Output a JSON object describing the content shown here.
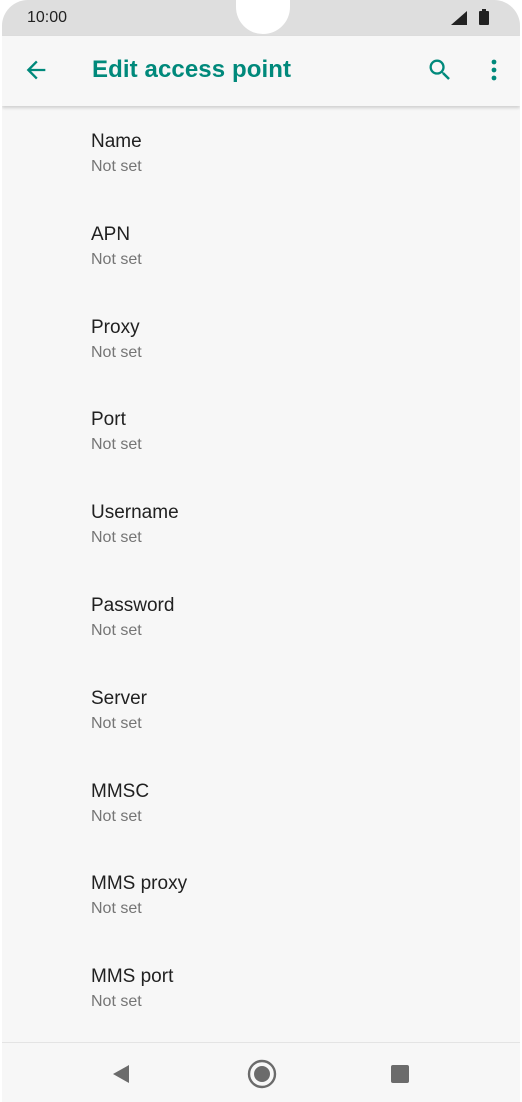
{
  "status_bar": {
    "time": "10:00",
    "icons": [
      "signal-icon",
      "battery-icon"
    ]
  },
  "app_bar": {
    "title": "Edit access point",
    "icons": {
      "back": "back-arrow-icon",
      "search": "search-icon",
      "more": "more-vert-icon"
    }
  },
  "fields": [
    {
      "label": "Name",
      "value": "Not set"
    },
    {
      "label": "APN",
      "value": "Not set"
    },
    {
      "label": "Proxy",
      "value": "Not set"
    },
    {
      "label": "Port",
      "value": "Not set"
    },
    {
      "label": "Username",
      "value": "Not set"
    },
    {
      "label": "Password",
      "value": "Not set"
    },
    {
      "label": "Server",
      "value": "Not set"
    },
    {
      "label": "MMSC",
      "value": "Not set"
    },
    {
      "label": "MMS proxy",
      "value": "Not set"
    },
    {
      "label": "MMS port",
      "value": "Not set"
    }
  ],
  "nav_bar": {
    "icons": [
      "nav-back-icon",
      "nav-home-icon",
      "nav-recents-icon"
    ]
  },
  "colors": {
    "accent": "#00897b",
    "background": "#f7f7f7",
    "status_bar": "#dedede",
    "title_text": "#212121",
    "summary_text": "#757575"
  }
}
